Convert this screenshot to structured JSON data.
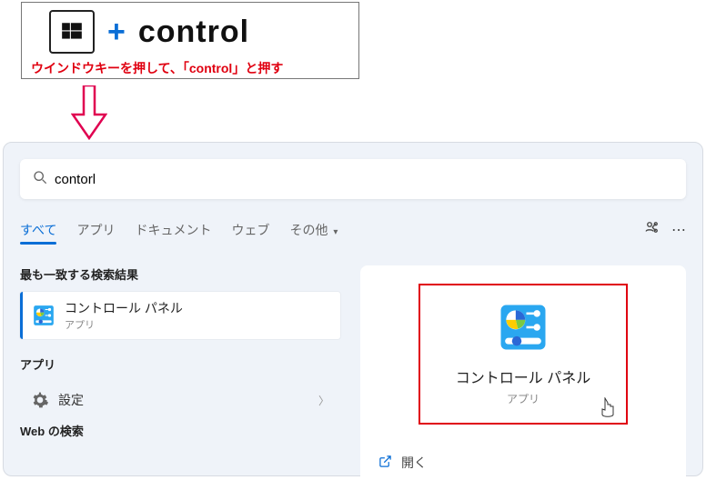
{
  "tutorial": {
    "plus": "+",
    "control_text": "control",
    "caption": "ウインドウキーを押して、「control」と押す"
  },
  "search": {
    "value": "contorl"
  },
  "tabs": {
    "all": "すべて",
    "apps": "アプリ",
    "documents": "ドキュメント",
    "web": "ウェブ",
    "more": "その他"
  },
  "left": {
    "best_match_header": "最も一致する検索結果",
    "best_match_title": "コントロール パネル",
    "best_match_sub": "アプリ",
    "apps_header": "アプリ",
    "settings_label": "設定",
    "web_header": "Web の検索"
  },
  "preview": {
    "title": "コントロール パネル",
    "sub": "アプリ",
    "open_label": "開く"
  }
}
